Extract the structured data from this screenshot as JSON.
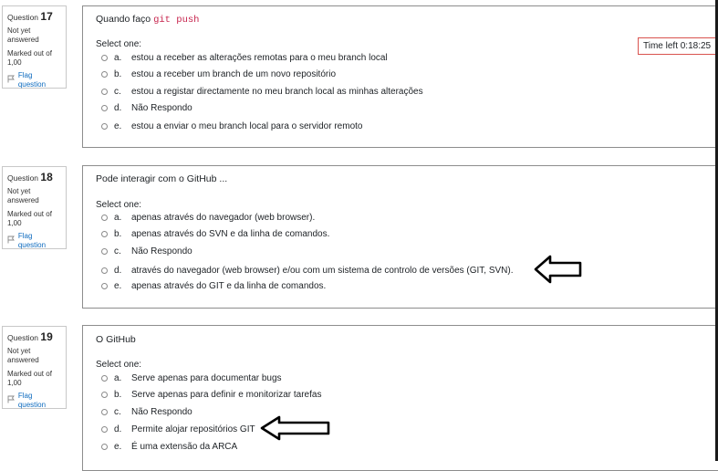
{
  "timer": {
    "label": "Time left",
    "value": "0:18:25"
  },
  "prompt_label": "Select one:",
  "flag_label": "Flag question",
  "questions": [
    {
      "label": "Question",
      "number": "17",
      "state": [
        "Not yet",
        "answered"
      ],
      "grade": [
        "Marked out of",
        "1,00"
      ],
      "text_prefix": "Quando faço",
      "text_code": "git push",
      "options": [
        {
          "letter": "a.",
          "text": "estou a receber as alterações remotas para o meu branch local"
        },
        {
          "letter": "b.",
          "text": "estou a receber um branch de um novo repositório"
        },
        {
          "letter": "c.",
          "text": "estou a registar directamente no meu branch local as minhas alterações"
        },
        {
          "letter": "d.",
          "text": "Não Respondo"
        },
        {
          "letter": "e.",
          "text": "estou a enviar o meu branch local para o servidor remoto"
        }
      ]
    },
    {
      "label": "Question",
      "number": "18",
      "state": [
        "Not yet",
        "answered"
      ],
      "grade": [
        "Marked out of",
        "1,00"
      ],
      "text": "Pode interagir com o GitHub ...",
      "options": [
        {
          "letter": "a.",
          "text": "apenas através do navegador (web browser)."
        },
        {
          "letter": "b.",
          "text": "apenas através do SVN e da linha de comandos."
        },
        {
          "letter": "c.",
          "text": "Não Respondo"
        },
        {
          "letter": "d.",
          "text": "através do navegador (web browser) e/ou com um sistema de controlo de versões (GIT, SVN)."
        },
        {
          "letter": "e.",
          "text": "apenas através do GIT e da linha de comandos."
        }
      ]
    },
    {
      "label": "Question",
      "number": "19",
      "state": [
        "Not yet",
        "answered"
      ],
      "grade": [
        "Marked out of",
        "1,00"
      ],
      "text": "O GitHub",
      "options": [
        {
          "letter": "a.",
          "text": "Serve apenas para documentar bugs"
        },
        {
          "letter": "b.",
          "text": "Serve apenas para definir e monitorizar tarefas"
        },
        {
          "letter": "c.",
          "text": "Não Respondo"
        },
        {
          "letter": "d.",
          "text": "Permite alojar repositórios GIT"
        },
        {
          "letter": "e.",
          "text": "É uma extensão da ARCA"
        }
      ]
    }
  ],
  "annotations": [
    {
      "name": "arrow-pointing-left",
      "points_at": "question 18 option d"
    },
    {
      "name": "arrow-pointing-left",
      "points_at": "question 19 option d"
    }
  ]
}
